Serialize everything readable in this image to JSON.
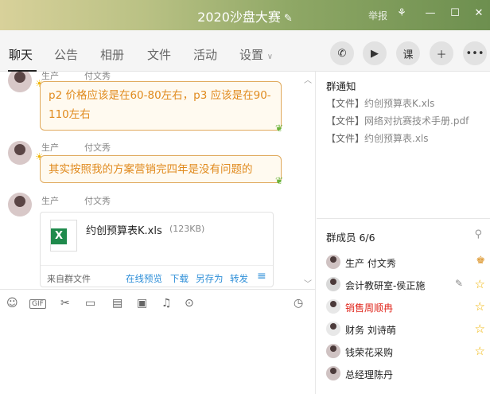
{
  "window": {
    "title": "2020沙盘大赛",
    "report_label": "举报"
  },
  "tabs": [
    {
      "label": "聊天"
    },
    {
      "label": "公告"
    },
    {
      "label": "相册"
    },
    {
      "label": "文件"
    },
    {
      "label": "活动"
    },
    {
      "label": "设置"
    }
  ],
  "toolbar": {
    "lesson_label": "课"
  },
  "messages": [
    {
      "sender_role": "生产",
      "sender_name": "付文秀",
      "text": "p2 价格应该是在60-80左右，p3 应该是在90-110左右"
    },
    {
      "sender_role": "生产",
      "sender_name": "付文秀",
      "text": "其实按照我的方案营销完四年是没有问题的"
    },
    {
      "sender_role": "生产",
      "sender_name": "付文秀",
      "file": {
        "name": "约创预算表K.xls",
        "size": "(123KB)",
        "source": "来自群文件",
        "actions": [
          "在线预览",
          "下载",
          "另存为",
          "转发"
        ]
      }
    }
  ],
  "notice": {
    "title": "群通知",
    "items": [
      {
        "tag": "【文件】",
        "name": "约创预算表K.xls"
      },
      {
        "tag": "【文件】",
        "name": "网络对抗赛技术手册.pdf"
      },
      {
        "tag": "【文件】",
        "name": "约创预算表.xls"
      }
    ]
  },
  "members": {
    "title": "群成员 6/6",
    "list": [
      {
        "name": "生产        付文秀"
      },
      {
        "name": "会计教研室-侯正施"
      },
      {
        "name": "销售周顺冉"
      },
      {
        "name": "财务  刘诗萌"
      },
      {
        "name": "钱荣花采购"
      },
      {
        "name": "总经理陈丹"
      }
    ]
  },
  "colors": {
    "accent": "#e08a1d",
    "link": "#2f8fd8",
    "titlebar": "#8ea765",
    "alert_name": "#e0251b"
  }
}
